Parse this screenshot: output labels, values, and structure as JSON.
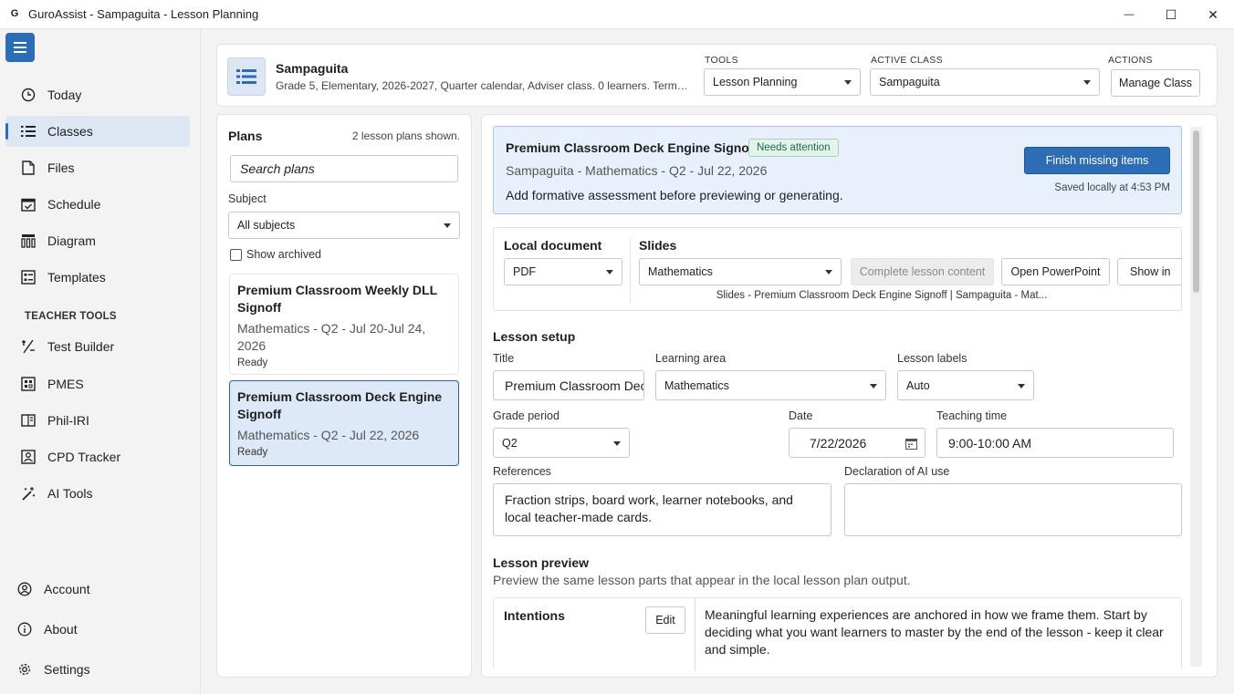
{
  "window": {
    "app_icon": "G",
    "title": "GuroAssist - Sampaguita - Lesson Planning",
    "minimize_glyph": "—",
    "maximize_glyph": "☐",
    "close_glyph": "✕"
  },
  "sidebar": {
    "menu_icon": "hamburger-icon",
    "items": [
      {
        "label": "Today",
        "icon": "clock-icon"
      },
      {
        "label": "Classes",
        "icon": "list-icon",
        "active": true
      },
      {
        "label": "Files",
        "icon": "file-icon"
      },
      {
        "label": "Schedule",
        "icon": "calendar-icon"
      },
      {
        "label": "Diagram",
        "icon": "diagram-icon"
      },
      {
        "label": "Templates",
        "icon": "template-icon"
      }
    ],
    "section_label": "TEACHER TOOLS",
    "tools": [
      {
        "label": "Test Builder",
        "icon": "test-icon"
      },
      {
        "label": "PMES",
        "icon": "calculator-icon"
      },
      {
        "label": "Phil-IRI",
        "icon": "book-icon"
      },
      {
        "label": "CPD Tracker",
        "icon": "people-icon"
      },
      {
        "label": "AI Tools",
        "icon": "magic-wand-icon"
      }
    ],
    "footer": [
      {
        "label": "Account",
        "icon": "account-icon"
      },
      {
        "label": "About",
        "icon": "info-icon"
      },
      {
        "label": "Settings",
        "icon": "gear-icon"
      }
    ]
  },
  "header": {
    "class_name": "Sampaguita",
    "class_desc": "Grade 5, Elementary, 2026-2027, Quarter calendar, Adviser class. 0 learners. Term 1 In...",
    "tools_label": "TOOLS",
    "tools_value": "Lesson Planning",
    "active_class_label": "ACTIVE CLASS",
    "active_class_value": "Sampaguita",
    "actions_label": "ACTIONS",
    "manage_class": "Manage Class"
  },
  "plans": {
    "title": "Plans",
    "count": "2 lesson plans shown.",
    "search_placeholder": "Search plans",
    "subject_label": "Subject",
    "subject_value": "All subjects",
    "show_archived": "Show archived",
    "items": [
      {
        "title": "Premium Classroom Weekly DLL Signoff",
        "sub": "Mathematics - Q2 - Jul 20-Jul 24, 2026",
        "status": "Ready"
      },
      {
        "title": "Premium Classroom Deck Engine Signoff",
        "sub": "Mathematics - Q2 - Jul 22, 2026",
        "status": "Ready"
      }
    ]
  },
  "detail": {
    "alert": {
      "title": "Premium Classroom Deck Engine Signoff",
      "badge": "Needs attention",
      "sub": "Sampaguita - Mathematics - Q2 - Jul 22, 2026",
      "message": "Add formative assessment before previewing or generating.",
      "primary_button": "Finish missing items",
      "saved": "Saved locally at 4:53 PM"
    },
    "doc": {
      "local_label": "Local document",
      "local_value": "PDF",
      "slides_label": "Slides",
      "slides_value": "Mathematics",
      "complete_button": "Complete lesson content",
      "open_ppt_button": "Open PowerPoint",
      "show_in_button": "Show in",
      "slides_caption": "Slides - Premium Classroom Deck Engine Signoff | Sampaguita - Mat..."
    },
    "setup": {
      "title": "Lesson setup",
      "title_label": "Title",
      "title_value": "Premium Classroom Deck Engine Signoff",
      "area_label": "Learning area",
      "area_value": "Mathematics",
      "labels_label": "Lesson labels",
      "labels_value": "Auto",
      "period_label": "Grade period",
      "period_value": "Q2",
      "date_label": "Date",
      "date_value": "7/22/2026",
      "time_label": "Teaching time",
      "time_value": "9:00-10:00 AM",
      "refs_label": "References",
      "refs_value": "Fraction strips, board work, learner notebooks, and local teacher-made cards.",
      "ai_label": "Declaration of AI use",
      "ai_value": ""
    },
    "preview": {
      "title": "Lesson preview",
      "desc": "Preview the same lesson parts that appear in the local lesson plan output.",
      "intent_label": "Intentions",
      "edit_button": "Edit",
      "intent_text": "Meaningful learning experiences are anchored in how we frame them. Start by deciding what you want learners to master by the end of the lesson - keep it clear and simple."
    }
  },
  "colors": {
    "accent": "#2d6db5",
    "selected_bg": "#dde9f8",
    "alert_bg": "#e8f1fb",
    "badge_text": "#1c6b45"
  }
}
